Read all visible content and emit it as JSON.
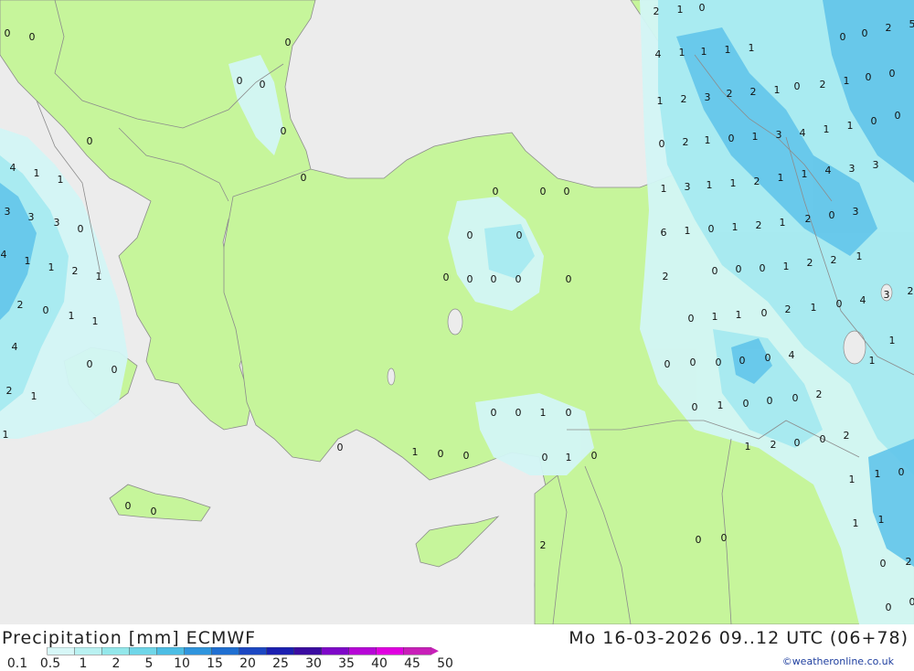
{
  "title": {
    "product": "Precipitation [mm] ECMWF",
    "valid_time": "Mo 16-03-2026 09..12 UTC (06+78)"
  },
  "credit": "©weatheronline.co.uk",
  "legend": {
    "ticks": [
      "0.1",
      "0.5",
      "1",
      "2",
      "5",
      "10",
      "15",
      "20",
      "25",
      "30",
      "35",
      "40",
      "45",
      "50"
    ],
    "colors": [
      "#d7f7f7",
      "#b9f1f1",
      "#93e7ea",
      "#6fd6e8",
      "#4cbde4",
      "#2f95dd",
      "#1f6fd1",
      "#1c47c2",
      "#1b1fb0",
      "#3a0ca0",
      "#7e08c8",
      "#b606d6",
      "#e000e0",
      "#c81fb8"
    ]
  },
  "colors": {
    "sea": "#ececec",
    "land": "#c6f59b",
    "precip_light": "#d3f5f5",
    "precip_medium": "#a6eaf0",
    "precip_heavy": "#62c5ea",
    "border": "#8c8c8c"
  },
  "values": [
    {
      "text": "0",
      "area": "NW Balkans"
    },
    {
      "text": "0",
      "area": "NW Balkans"
    },
    {
      "text": "0",
      "area": "Bulgaria"
    },
    {
      "text": "0",
      "area": "Bulgaria"
    },
    {
      "text": "0",
      "area": "Bulgaria"
    },
    {
      "text": "0",
      "area": "Bulgaria coast"
    },
    {
      "text": "0",
      "area": "Balkans"
    },
    {
      "text": "0",
      "area": "Istanbul"
    },
    {
      "text": "4",
      "area": "Adriatic"
    },
    {
      "text": "1",
      "area": "Adriatic"
    },
    {
      "text": "1",
      "area": "Adriatic"
    },
    {
      "text": "3",
      "area": "Adriatic"
    },
    {
      "text": "3",
      "area": "Adriatic"
    },
    {
      "text": "3",
      "area": "Adriatic"
    },
    {
      "text": "0",
      "area": "Albania"
    },
    {
      "text": "4",
      "area": "Adriatic"
    },
    {
      "text": "1",
      "area": "Albania"
    },
    {
      "text": "1",
      "area": "Albania"
    },
    {
      "text": "2",
      "area": "Albania"
    },
    {
      "text": "1",
      "area": "Greece"
    },
    {
      "text": "2",
      "area": "Ionian"
    },
    {
      "text": "0",
      "area": "Greece"
    },
    {
      "text": "1",
      "area": "Greece"
    },
    {
      "text": "1",
      "area": "Greece"
    },
    {
      "text": "4",
      "area": "Ionian"
    },
    {
      "text": "0",
      "area": "Greece"
    },
    {
      "text": "0",
      "area": "Greece"
    },
    {
      "text": "2",
      "area": "Ionian"
    },
    {
      "text": "1",
      "area": "Ionian"
    },
    {
      "text": "1",
      "area": "Ionian"
    },
    {
      "text": "0",
      "area": "Crete"
    },
    {
      "text": "0",
      "area": "Crete"
    },
    {
      "text": "0",
      "area": "Anatolia"
    },
    {
      "text": "0",
      "area": "Anatolia"
    },
    {
      "text": "0",
      "area": "Anatolia"
    },
    {
      "text": "0",
      "area": "Anatolia"
    },
    {
      "text": "0",
      "area": "Anatolia"
    },
    {
      "text": "0",
      "area": "Anatolia"
    },
    {
      "text": "0",
      "area": "Anatolia"
    },
    {
      "text": "0",
      "area": "Anatolia"
    },
    {
      "text": "0",
      "area": "Anatolia"
    },
    {
      "text": "0",
      "area": "Anatolia"
    },
    {
      "text": "0",
      "area": "South Anatolia"
    },
    {
      "text": "0",
      "area": "South Anatolia"
    },
    {
      "text": "1",
      "area": "South Anatolia"
    },
    {
      "text": "0",
      "area": "South Anatolia"
    },
    {
      "text": "0",
      "area": "South coast"
    },
    {
      "text": "1",
      "area": "South coast"
    },
    {
      "text": "0",
      "area": "South coast"
    },
    {
      "text": "0",
      "area": "South coast"
    },
    {
      "text": "0",
      "area": "Levant"
    },
    {
      "text": "1",
      "area": "Levant"
    },
    {
      "text": "0",
      "area": "Levant"
    },
    {
      "text": "2",
      "area": "Levant"
    },
    {
      "text": "0",
      "area": "Syria"
    },
    {
      "text": "0",
      "area": "Syria"
    },
    {
      "text": "2",
      "area": "Caucasus"
    },
    {
      "text": "1",
      "area": "Caucasus"
    },
    {
      "text": "0",
      "area": "Caucasus"
    },
    {
      "text": "0",
      "area": "Caucasus"
    },
    {
      "text": "2",
      "area": "Caucasus"
    },
    {
      "text": "5",
      "area": "Caucasus"
    },
    {
      "text": "4",
      "area": "Caucasus"
    },
    {
      "text": "1",
      "area": "Caucasus"
    },
    {
      "text": "1",
      "area": "Caucasus"
    },
    {
      "text": "1",
      "area": "Caucasus"
    },
    {
      "text": "1",
      "area": "Caucasus"
    },
    {
      "text": "0",
      "area": "Caucasus"
    },
    {
      "text": "0",
      "area": "Caucasus"
    },
    {
      "text": "2",
      "area": "Caucasus"
    },
    {
      "text": "1",
      "area": "Caucasus"
    },
    {
      "text": "0",
      "area": "Caucasus"
    },
    {
      "text": "0",
      "area": "NE Turkey"
    },
    {
      "text": "1",
      "area": "NE Turkey"
    },
    {
      "text": "2",
      "area": "NE Turkey"
    },
    {
      "text": "3",
      "area": "NE Turkey"
    },
    {
      "text": "2",
      "area": "NE Turkey"
    },
    {
      "text": "2",
      "area": "NE Turkey"
    },
    {
      "text": "1",
      "area": "NE Turkey"
    },
    {
      "text": "0",
      "area": "NE Turkey"
    },
    {
      "text": "2",
      "area": "NE Turkey"
    },
    {
      "text": "1",
      "area": "NE Turkey"
    },
    {
      "text": "0",
      "area": "NE Turkey"
    },
    {
      "text": "1",
      "area": "NE Turkey"
    },
    {
      "text": "3",
      "area": "NE Turkey"
    },
    {
      "text": "4",
      "area": "NE Turkey"
    },
    {
      "text": "1",
      "area": "NE Turkey"
    },
    {
      "text": "1",
      "area": "NE Turkey"
    },
    {
      "text": "0",
      "area": "NE Turkey"
    },
    {
      "text": "0",
      "area": "NE Turkey"
    },
    {
      "text": "1",
      "area": "NE Turkey"
    },
    {
      "text": "3",
      "area": "NE Turkey"
    },
    {
      "text": "1",
      "area": "NE Turkey"
    },
    {
      "text": "1",
      "area": "NE Turkey"
    },
    {
      "text": "2",
      "area": "NE Turkey"
    },
    {
      "text": "1",
      "area": "NE Turkey"
    },
    {
      "text": "1",
      "area": "NE Turkey"
    },
    {
      "text": "4",
      "area": "NE Turkey"
    },
    {
      "text": "3",
      "area": "NE Turkey"
    },
    {
      "text": "3",
      "area": "NE Turkey"
    },
    {
      "text": "6",
      "area": "NE Turkey"
    },
    {
      "text": "1",
      "area": "NE Turkey"
    },
    {
      "text": "0",
      "area": "East Turkey"
    },
    {
      "text": "1",
      "area": "East Turkey"
    },
    {
      "text": "2",
      "area": "East Turkey"
    },
    {
      "text": "1",
      "area": "East Turkey"
    },
    {
      "text": "2",
      "area": "East Turkey"
    },
    {
      "text": "0",
      "area": "East Turkey"
    },
    {
      "text": "3",
      "area": "East Turkey"
    },
    {
      "text": "2",
      "area": "East Turkey"
    },
    {
      "text": "0",
      "area": "East Turkey"
    },
    {
      "text": "0",
      "area": "East Turkey"
    },
    {
      "text": "0",
      "area": "East Turkey"
    },
    {
      "text": "1",
      "area": "East Turkey"
    },
    {
      "text": "2",
      "area": "East Turkey"
    },
    {
      "text": "2",
      "area": "East Turkey"
    },
    {
      "text": "1",
      "area": "East Turkey"
    },
    {
      "text": "3",
      "area": "East Turkey"
    },
    {
      "text": "2",
      "area": "East Turkey"
    },
    {
      "text": "0",
      "area": "East Turkey"
    },
    {
      "text": "1",
      "area": "East Turkey"
    },
    {
      "text": "1",
      "area": "East Turkey"
    },
    {
      "text": "0",
      "area": "East Turkey"
    },
    {
      "text": "2",
      "area": "East Turkey"
    },
    {
      "text": "1",
      "area": "East Turkey"
    },
    {
      "text": "0",
      "area": "East Turkey"
    },
    {
      "text": "4",
      "area": "East Turkey"
    },
    {
      "text": "1",
      "area": "East Turkey"
    },
    {
      "text": "0",
      "area": "East Turkey"
    },
    {
      "text": "0",
      "area": "East Turkey"
    },
    {
      "text": "0",
      "area": "SE Turkey"
    },
    {
      "text": "0",
      "area": "SE Turkey"
    },
    {
      "text": "0",
      "area": "SE Turkey"
    },
    {
      "text": "4",
      "area": "SE Turkey"
    },
    {
      "text": "1",
      "area": "SE Turkey"
    },
    {
      "text": "0",
      "area": "SE Turkey"
    },
    {
      "text": "1",
      "area": "SE Turkey"
    },
    {
      "text": "0",
      "area": "SE Turkey"
    },
    {
      "text": "0",
      "area": "SE Turkey"
    },
    {
      "text": "0",
      "area": "SE Turkey"
    },
    {
      "text": "2",
      "area": "SE Turkey"
    },
    {
      "text": "1",
      "area": "SE Turkey"
    },
    {
      "text": "2",
      "area": "SE Turkey"
    },
    {
      "text": "0",
      "area": "Iraq"
    },
    {
      "text": "0",
      "area": "Iraq"
    },
    {
      "text": "2",
      "area": "Iraq"
    },
    {
      "text": "1",
      "area": "Iraq"
    },
    {
      "text": "1",
      "area": "Iraq"
    },
    {
      "text": "0",
      "area": "Iran"
    },
    {
      "text": "1",
      "area": "Iran"
    },
    {
      "text": "1",
      "area": "Iran"
    },
    {
      "text": "0",
      "area": "Iran"
    },
    {
      "text": "2",
      "area": "Iran"
    },
    {
      "text": "0",
      "area": "Iran"
    },
    {
      "text": "0",
      "area": "Iran"
    },
    {
      "text": "1",
      "area": "Iran"
    },
    {
      "text": "2",
      "area": "Iran"
    }
  ]
}
